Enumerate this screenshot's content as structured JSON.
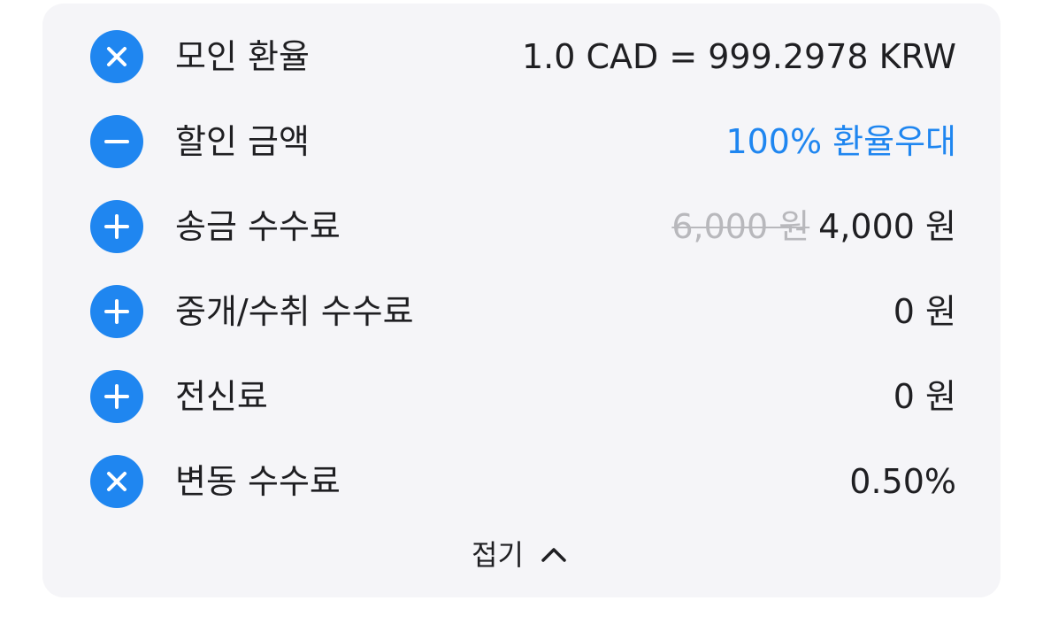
{
  "colors": {
    "accent": "#1f86f0",
    "card_bg": "#f5f5f8",
    "text": "#1f1f22",
    "muted": "#b8b8bc"
  },
  "rows": [
    {
      "icon": "multiply-icon",
      "label": "모인 환율",
      "value": "1.0 CAD = 999.2978 KRW"
    },
    {
      "icon": "minus-icon",
      "label": "할인 금액",
      "value": "100% 환율우대"
    },
    {
      "icon": "plus-icon",
      "label": "송금 수수료",
      "old_value": "6,000 원",
      "value": "4,000 원"
    },
    {
      "icon": "plus-icon",
      "label": "중개/수취 수수료",
      "value": "0 원"
    },
    {
      "icon": "plus-icon",
      "label": "전신료",
      "value": "0 원"
    },
    {
      "icon": "multiply-icon",
      "label": "변동 수수료",
      "value": "0.50%"
    }
  ],
  "collapse": {
    "label": "접기",
    "icon": "chevron-up-icon"
  }
}
